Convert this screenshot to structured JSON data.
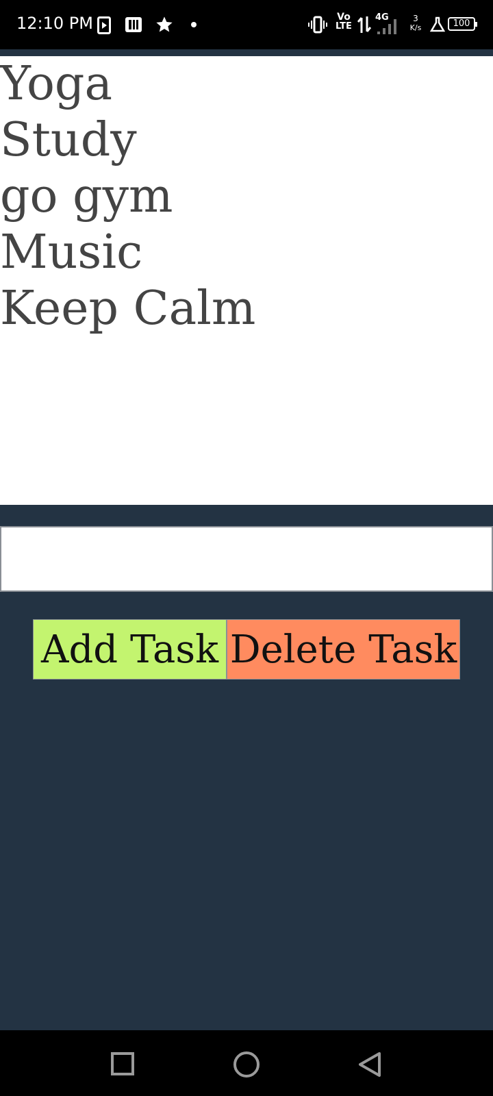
{
  "status_bar": {
    "time": "12:10 PM",
    "battery": "100",
    "network_type": "4G",
    "volte_top": "Vo",
    "volte_bottom": "LTE",
    "speed_value": "3",
    "speed_unit": "K/s",
    "icons": [
      "media-play-icon",
      "pocket-icon",
      "star-icon",
      "dot-icon",
      "vibrate-icon",
      "volte-icon",
      "data-arrows-icon",
      "signal-icon",
      "lab-icon",
      "battery-icon"
    ]
  },
  "tasks": [
    "Yoga",
    "Study",
    "go gym",
    "Music",
    "Keep Calm"
  ],
  "input": {
    "value": "",
    "placeholder": ""
  },
  "buttons": {
    "add_label": "Add Task",
    "delete_label": "Delete Task"
  },
  "nav_bar": {
    "icons": [
      "recents-square-icon",
      "home-circle-icon",
      "back-triangle-icon"
    ]
  },
  "colors": {
    "background": "#233343",
    "panel": "#ffffff",
    "task_text": "#444444",
    "add_button": "#c3f46f",
    "delete_button": "#ff8b5f"
  }
}
